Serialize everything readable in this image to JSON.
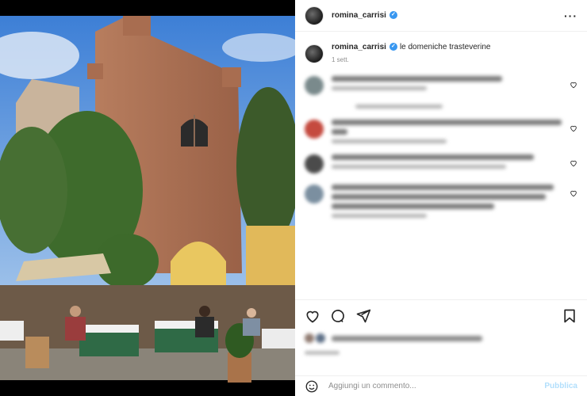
{
  "post": {
    "username": "romina_carrisi",
    "caption": "le domeniche trasteverine",
    "time": "1 sett."
  },
  "comment_box": {
    "placeholder": "Aggiungi un commento...",
    "publish_label": "Pubblica"
  },
  "icons": {
    "more": "more-options-icon",
    "like": "heart-icon",
    "comment": "comment-icon",
    "share": "send-icon",
    "save": "bookmark-icon",
    "emoji": "emoji-icon"
  },
  "colors": {
    "verified": "#3897f0",
    "publish": "#b2dffc"
  }
}
